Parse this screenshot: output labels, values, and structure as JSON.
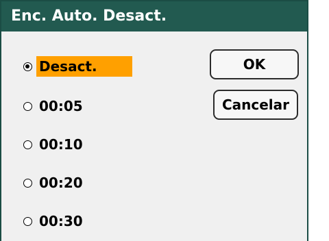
{
  "dialog": {
    "title": "Enc. Auto. Desact."
  },
  "options": [
    {
      "label": "Desact.",
      "selected": true
    },
    {
      "label": "00:05",
      "selected": false
    },
    {
      "label": "00:10",
      "selected": false
    },
    {
      "label": "00:20",
      "selected": false
    },
    {
      "label": "00:30",
      "selected": false
    }
  ],
  "buttons": {
    "ok_label": "OK",
    "cancel_label": "Cancelar"
  },
  "colors": {
    "titlebar": "#225a50",
    "highlight": "#ffa000",
    "background": "#f0f0f0"
  }
}
